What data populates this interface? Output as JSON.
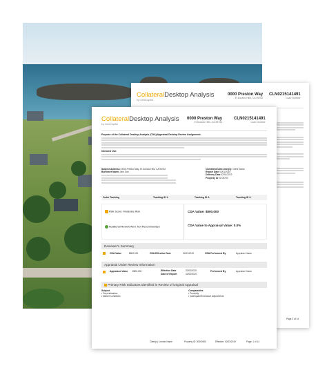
{
  "front": {
    "brand_main": "Collateral",
    "brand_rest": "Desktop Analysis",
    "brand_sub": "by ClearCapital",
    "address": "0000 Preston Way",
    "address_sub": "El Dorado Hills, CA 95762",
    "loan_number": "CLN0215141491",
    "loan_label": "Loan Number",
    "purpose_heading": "Purpose of the Collateral Desktop Analysis (CDA)/Appraisal Desktop Review Assignment:",
    "intended_use": "Intended Use:",
    "subject_address_label": "Subject Address:",
    "subject_address_value": "0000 Preston Way, El Dorado Hills, CA 95762",
    "borrower_label": "Borrower Name",
    "borrower_value": "John Doe",
    "client_label": "Client/Intended User(s):",
    "client_value": "Client Name",
    "report_date_label": "Report Date",
    "report_date_value": "02/01/2019",
    "delivery_label": "Delivery Date",
    "delivery_value": "02/01/2019",
    "property_id_label": "Property ID",
    "property_id_value": "00 00760",
    "order_tracking": "Order Tracking",
    "tracking_id1": "Tracking ID 1:",
    "tracking_id2": "Tracking ID 2:",
    "tracking_id3": "Tracking ID 3:",
    "risk_score_label": "Risk Score: Moderate Risk",
    "review_alert_label": "Additional Review Alert: Not Recommended",
    "cda_value": "CDA Value: $800,000",
    "cda_ratio": "CDA Value to Appraisal Value: 0.0%",
    "reviewer_summary": "Reviewer's Summary",
    "cda_value_short": "CDA Value",
    "cda_value_amt": "$800,000",
    "cda_eff_date": "CDA Effective Date",
    "cda_eff_date_val": "02/03/2019",
    "performed_by": "CDA Performed By",
    "performed_by_val": "Appraiser Name",
    "appraisal_heading": "Appraisal Under Review Information",
    "appraised_value": "Appraised Value",
    "appraised_value_amt": "$800,000",
    "effective_date": "Effective Date",
    "effective_date_val": "02/03/2019",
    "date_of_report": "Date of Report",
    "date_of_report_val": "02/03/2019",
    "performed_by2": "Performed By",
    "performed_by2_val": "Appraiser Name",
    "primary_risk": "Primary Risk Indicators Identified in Review of Original Appraisal",
    "subject_col": "Subject",
    "comparables_col": "Comparables",
    "bullet_s1": "Overestimation",
    "bullet_s2": "Market Conditions",
    "bullet_c1": "Proximity",
    "bullet_c2": "Inadequate/Excessive Adjustments",
    "footer_client": "Client(s): Lender Name",
    "footer_property": "Property ID: 00000000",
    "footer_effective": "Effective: 02/03/2019",
    "footer_page": "Page: 1 of 14"
  },
  "back": {
    "brand_main": "Collateral",
    "brand_rest": "Desktop Analysis",
    "brand_sub": "by ClearCapital",
    "address": "0000 Preston Way",
    "address_sub": "El Dorado Hills, CA 95762",
    "loan_number": "CLN0215141491",
    "loan_label": "Loan Number",
    "footer_page": "Page 2 of 14"
  }
}
